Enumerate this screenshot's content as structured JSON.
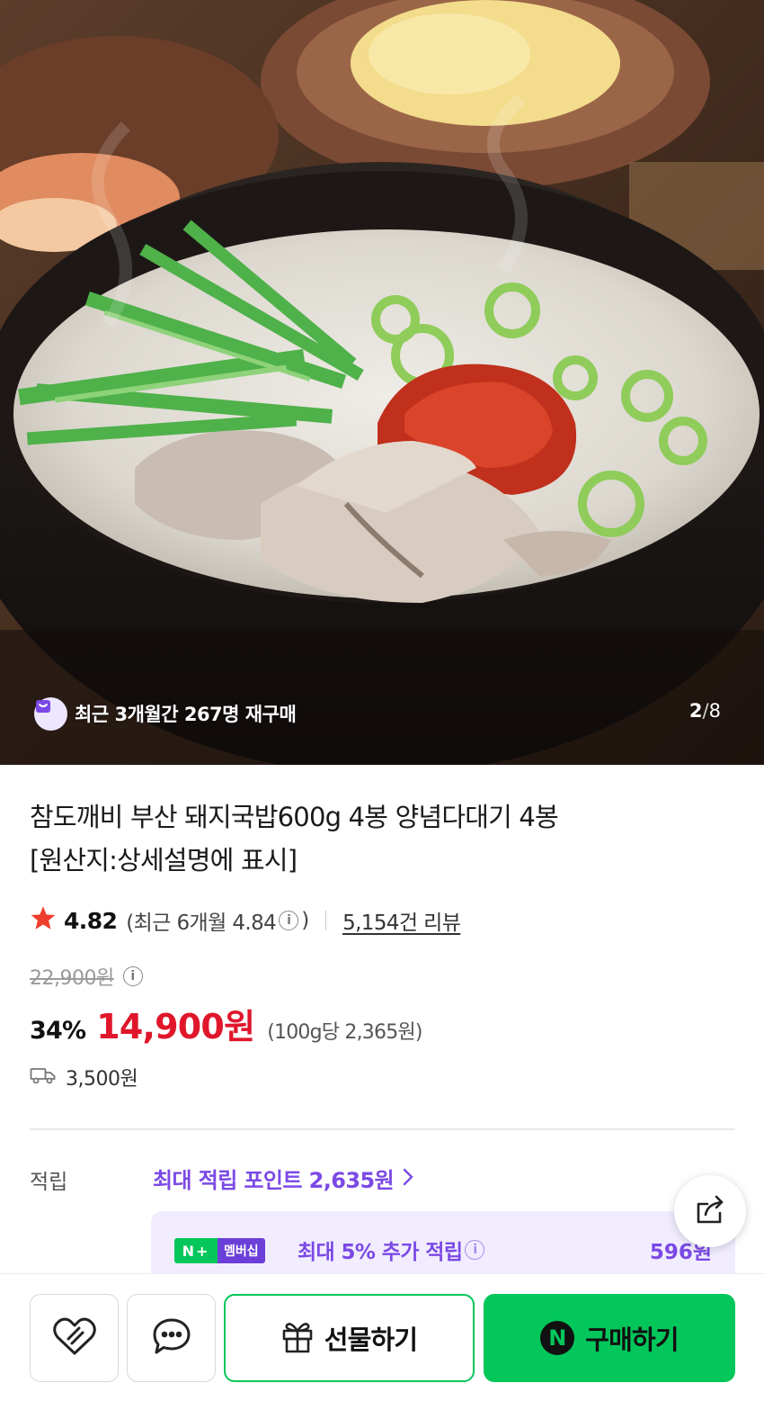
{
  "hero": {
    "repurchase_text": "최근 3개월간 267명 재구매",
    "pager_current": "2",
    "pager_total": "8"
  },
  "product": {
    "title_line1": "참도깨비 부산 돼지국밥600g 4봉 양념다대기 4봉",
    "title_line2": "[원산지:상세설명에 표시]",
    "rating": "4.82",
    "recent_rating_prefix": "(최근 6개월 4.84",
    "recent_rating_suffix": ")",
    "review_count": "5,154건 리뷰",
    "original_price": "22,900원",
    "discount": "34%",
    "sale_price": "14,900원",
    "unit_price": "(100g당 2,365원)",
    "shipping_fee": "3,500원"
  },
  "points": {
    "label": "적립",
    "max_points": "최대 적립 포인트 2,635원",
    "nplus_badge_n": "N+",
    "nplus_badge_member": "멤버십",
    "nplus_text": "최대 5% 추가 적립",
    "nplus_amount": "596원"
  },
  "bottom_bar": {
    "gift_label": "선물하기",
    "buy_label": "구매하기",
    "buy_badge": "N"
  },
  "colors": {
    "sale_red": "#e0162b",
    "naver_green": "#03c75a",
    "points_purple": "#7b49e5"
  },
  "icons": [
    "heart-icon",
    "chat-icon",
    "gift-icon",
    "share-icon",
    "star-icon",
    "truck-icon",
    "info-icon",
    "chevron-right-icon"
  ]
}
